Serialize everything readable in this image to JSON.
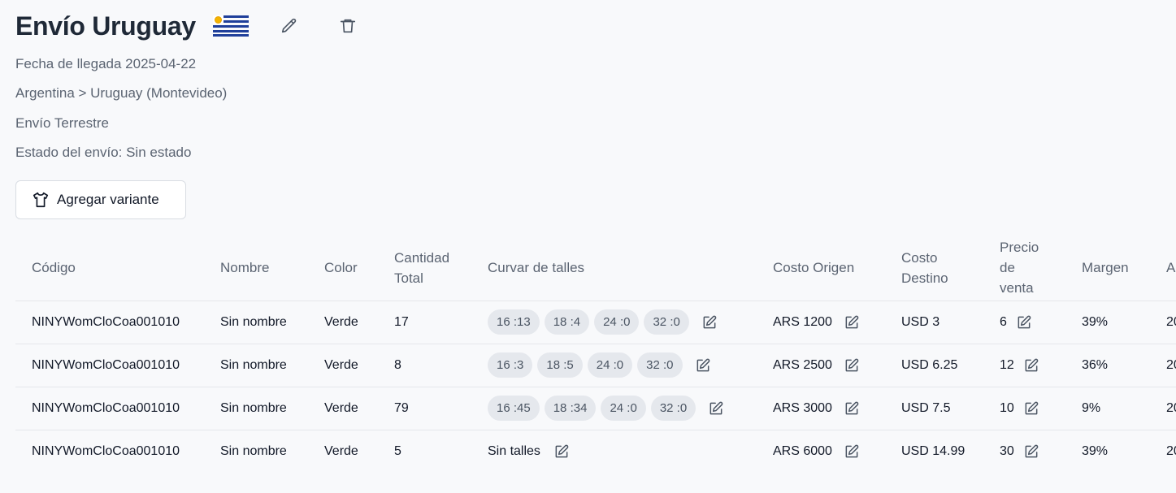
{
  "shipment": {
    "title": "Envío Uruguay",
    "arrival": "Fecha de llegada 2025-04-22",
    "route": "Argentina > Uruguay (Montevideo)",
    "method": "Envío Terrestre",
    "status": "Estado del envío: Sin estado"
  },
  "actions": {
    "add_variant": "Agregar variante"
  },
  "table": {
    "headers": {
      "code": "Código",
      "name": "Nombre",
      "color": "Color",
      "qty": "Cantidad Total",
      "sizes": "Curvar de talles",
      "origin_cost": "Costo Origen",
      "dest_cost": "Costo Destino",
      "price": "Precio de venta",
      "margin": "Margen",
      "extra": "A"
    },
    "rows": [
      {
        "code": "NINYWomCloCoa001010",
        "name": "Sin nombre",
        "color": "Verde",
        "qty": "17",
        "sizes": [
          "16 :13",
          "18 :4",
          "24 :0",
          "32 :0"
        ],
        "no_sizes": "",
        "origin_cost": "ARS 1200",
        "dest_cost": "USD 3",
        "price": "6",
        "margin": "39%",
        "extra": "20"
      },
      {
        "code": "NINYWomCloCoa001010",
        "name": "Sin nombre",
        "color": "Verde",
        "qty": "8",
        "sizes": [
          "16 :3",
          "18 :5",
          "24 :0",
          "32 :0"
        ],
        "no_sizes": "",
        "origin_cost": "ARS 2500",
        "dest_cost": "USD 6.25",
        "price": "12",
        "margin": "36%",
        "extra": "20"
      },
      {
        "code": "NINYWomCloCoa001010",
        "name": "Sin nombre",
        "color": "Verde",
        "qty": "79",
        "sizes": [
          "16 :45",
          "18 :34",
          "24 :0",
          "32 :0"
        ],
        "no_sizes": "",
        "origin_cost": "ARS 3000",
        "dest_cost": "USD 7.5",
        "price": "10",
        "margin": "9%",
        "extra": "20"
      },
      {
        "code": "NINYWomCloCoa001010",
        "name": "Sin nombre",
        "color": "Verde",
        "qty": "5",
        "sizes": [],
        "no_sizes": "Sin talles",
        "origin_cost": "ARS 6000",
        "dest_cost": "USD 14.99",
        "price": "30",
        "margin": "39%",
        "extra": "20"
      }
    ]
  },
  "icons": {
    "flag": "uruguay-flag-icon",
    "edit": "pencil-icon",
    "delete": "trash-icon",
    "shirt": "shirt-icon",
    "row_edit": "edit-square-icon"
  }
}
